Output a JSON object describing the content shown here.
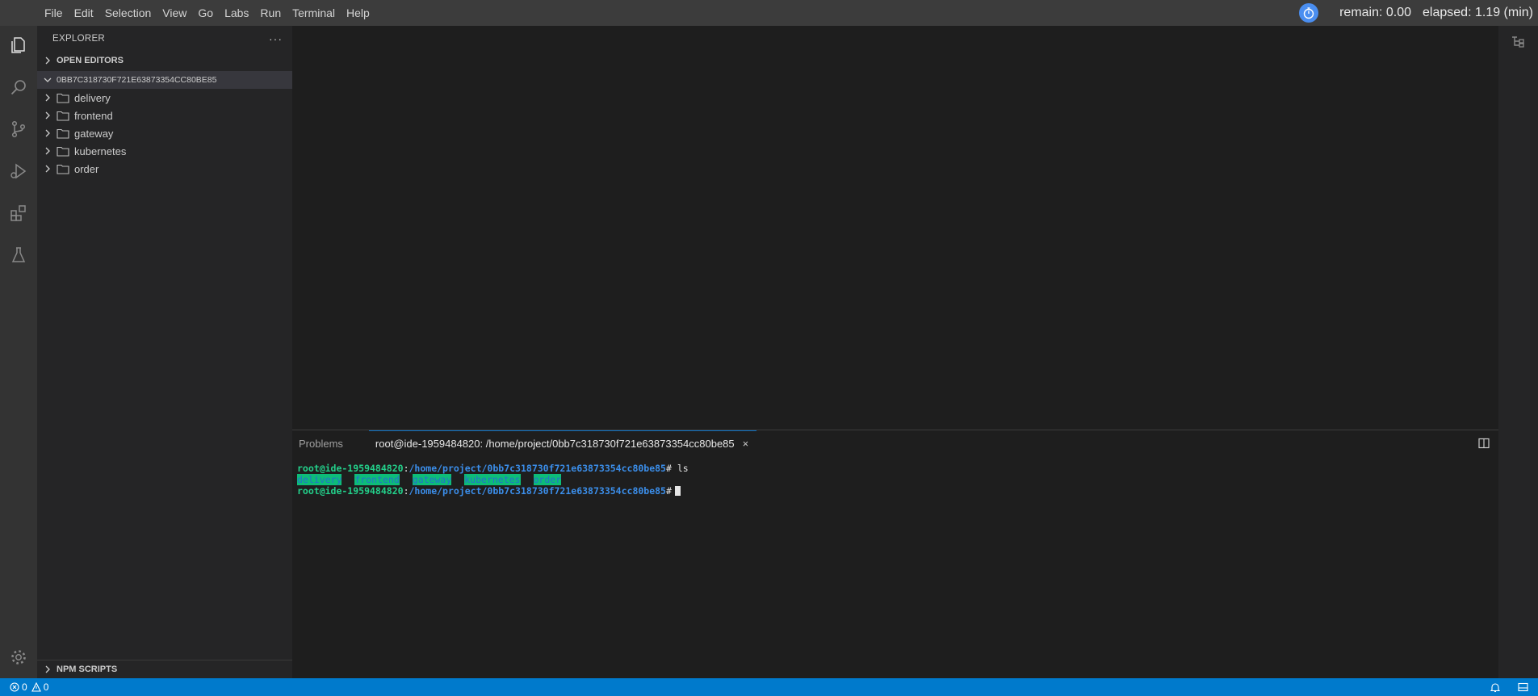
{
  "menubar": {
    "items": [
      "File",
      "Edit",
      "Selection",
      "View",
      "Go",
      "Labs",
      "Run",
      "Terminal",
      "Help"
    ],
    "remain": "remain: 0.00",
    "elapsed": "elapsed: 1.19 (min)"
  },
  "activity": {
    "icons": [
      "files-icon",
      "search-icon",
      "source-control-icon",
      "run-debug-icon",
      "extensions-icon",
      "flask-icon",
      "gear-icon"
    ]
  },
  "sidebar": {
    "title": "EXPLORER",
    "more": "···",
    "open_editors": "OPEN EDITORS",
    "project": "0BB7C318730F721E63873354CC80BE85",
    "folders": [
      "delivery",
      "frontend",
      "gateway",
      "kubernetes",
      "order"
    ],
    "npm_scripts": "NPM SCRIPTS"
  },
  "panel": {
    "tab_problems": "Problems",
    "tab_terminal": "root@ide-1959484820: /home/project/0bb7c318730f721e63873354cc80be85",
    "close": "×"
  },
  "terminal": {
    "user": "root@ide-1959484820",
    "sep": ":",
    "path": "/home/project/0bb7c318730f721e63873354cc80be85",
    "prompt": "#",
    "command": "ls",
    "dirs": [
      "delivery",
      "frontend",
      "gateway",
      "kubernetes",
      "order"
    ]
  },
  "statusbar": {
    "errors": "0",
    "warnings": "0"
  },
  "colors": {
    "accent": "#007acc",
    "terminal_green": "#23d18b",
    "terminal_blue": "#3b8eea",
    "dir_bg": "#0dbc79"
  }
}
